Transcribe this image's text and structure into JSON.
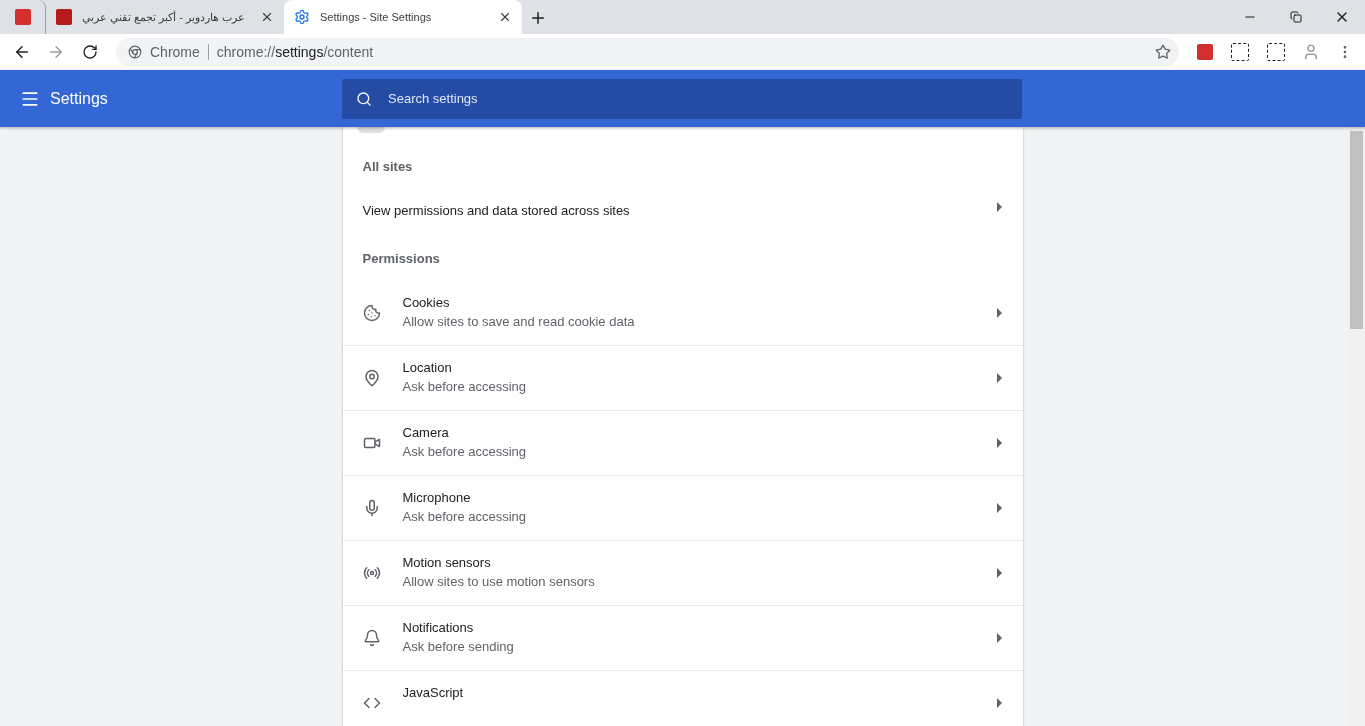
{
  "tabs": [
    {
      "selected": false,
      "kind": "pinned"
    },
    {
      "title": "عرب هاردوير - أكبر تجمع تقني عربي",
      "selected": false,
      "kind": "normal"
    },
    {
      "title": "Settings - Site Settings",
      "selected": true,
      "kind": "normal"
    }
  ],
  "address_bar": {
    "site_label": "Chrome",
    "url": "chrome://**settings**/content"
  },
  "header": {
    "title": "Settings",
    "search": {
      "placeholder": "Search settings"
    }
  },
  "sections": [
    {
      "heading": "All sites",
      "items": [
        {
          "label": "View permissions and data stored across sites"
        }
      ]
    },
    {
      "heading": "Permissions",
      "items": [
        {
          "label": "Cookies",
          "description": "Allow sites to save and read cookie data"
        },
        {
          "label": "Location",
          "description": "Ask before accessing"
        },
        {
          "label": "Camera",
          "description": "Ask before accessing"
        },
        {
          "label": "Microphone",
          "description": "Ask before accessing"
        },
        {
          "label": "Motion sensors",
          "description": "Allow sites to use motion sensors"
        },
        {
          "label": "Notifications",
          "description": "Ask before sending"
        },
        {
          "label": "JavaScript"
        }
      ]
    }
  ]
}
